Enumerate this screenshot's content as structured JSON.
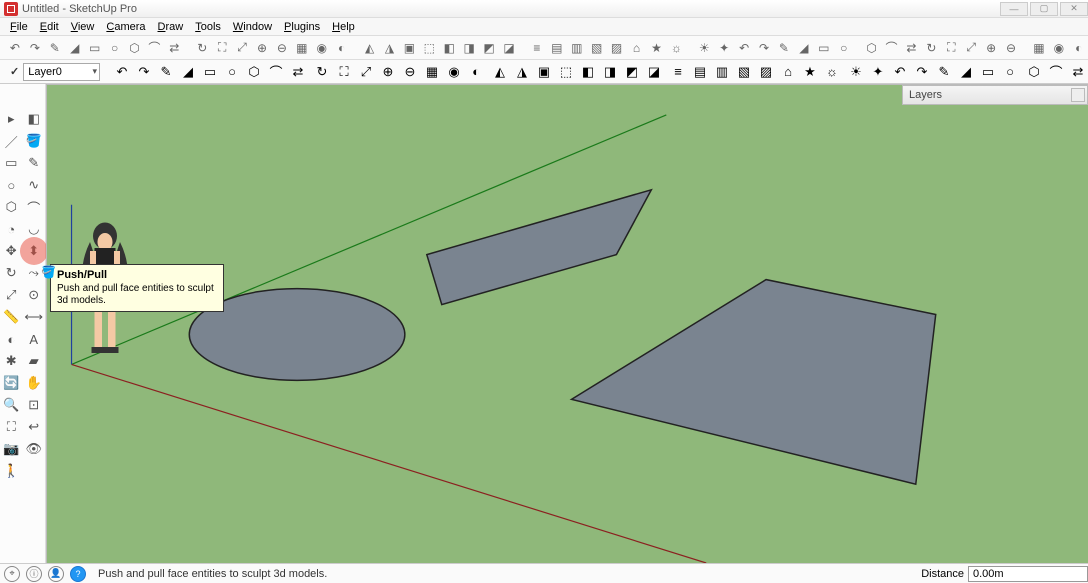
{
  "title": "Untitled - SketchUp Pro",
  "menu": [
    "File",
    "Edit",
    "View",
    "Camera",
    "Draw",
    "Tools",
    "Window",
    "Plugins",
    "Help"
  ],
  "layer": {
    "current": "Layer0"
  },
  "layers_panel": {
    "title": "Layers"
  },
  "tooltip": {
    "title": "Push/Pull",
    "body": "Push and pull face entities to sculpt 3d models."
  },
  "status": {
    "hint": "Push and pull face entities to sculpt 3d models.",
    "distance_label": "Distance",
    "distance_value": "0.00m"
  },
  "left_tools": [
    [
      "select-tool",
      "eraser-tool"
    ],
    [
      "line-tool",
      "paint-tool"
    ],
    [
      "rectangle-tool",
      "pencil-tool"
    ],
    [
      "circle-tool",
      "freehand-tool"
    ],
    [
      "polygon-tool",
      "arc-tool"
    ],
    [
      "pie-tool",
      "arc2-tool"
    ],
    [
      "move-tool",
      "pushpull-tool"
    ],
    [
      "rotate-tool",
      "followme-tool"
    ],
    [
      "scale-tool",
      "offset-tool"
    ],
    [
      "tape-tool",
      "dimension-tool"
    ],
    [
      "protractor-tool",
      "text-tool"
    ],
    [
      "axes-tool",
      "section-tool"
    ],
    [
      "orbit-tool",
      "pan-tool"
    ],
    [
      "zoom-tool",
      "zoom-window-tool"
    ],
    [
      "zoom-extents-tool",
      "previous-view-tool"
    ],
    [
      "position-camera-tool",
      "look-around-tool"
    ],
    [
      "walk-tool",
      ""
    ]
  ],
  "highlighted_tool": "pushpull-tool",
  "toolbar_rows": {
    "row1_count": 52,
    "row2_count": 44
  }
}
